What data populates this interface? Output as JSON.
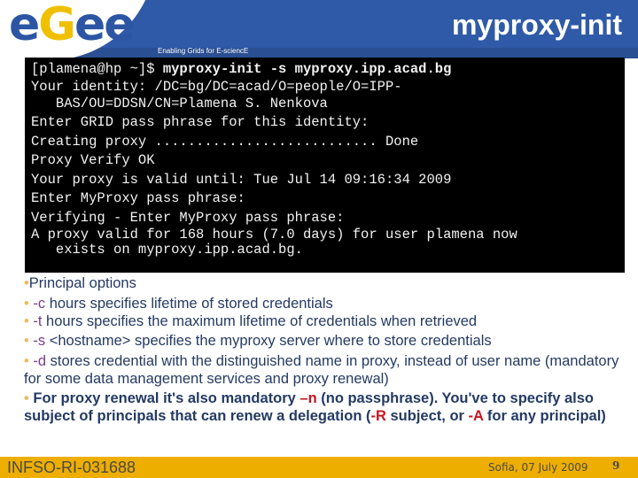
{
  "header": {
    "logo_letters": [
      "e",
      "G",
      "e",
      "e"
    ],
    "tagline": "Enabling Grids for E-sciencE",
    "title": "myproxy-init",
    "colors": {
      "header_blue": "#2f5aa8",
      "logo_blue": "#2c56a4",
      "logo_yellow": "#f0c000"
    }
  },
  "terminal": {
    "prompt": "[plamena@hp ~]$ ",
    "command": "myproxy-init -s myproxy.ipp.acad.bg",
    "lines": [
      "Your identity: /DC=bg/DC=acad/O=people/O=IPP-",
      "   BAS/OU=DDSN/CN=Plamena S. Nenkova",
      "Enter GRID pass phrase for this identity:",
      "Creating proxy ........................... Done",
      "Proxy Verify OK",
      "Your proxy is valid until: Tue Jul 14 09:16:34 2009",
      "Enter MyProxy pass phrase:",
      "Verifying - Enter MyProxy pass phrase:",
      "A proxy valid for 168 hours (7.0 days) for user plamena now",
      "   exists on myproxy.ipp.acad.bg."
    ]
  },
  "bullets": {
    "marker": "•",
    "heading": "Principal options",
    "items": [
      {
        "flag": "-c",
        "text": " hours specifies lifetime of stored credentials"
      },
      {
        "flag": "-t",
        "text": "  hours  specifies the maximum lifetime of credentials when retrieved"
      },
      {
        "flag": "-s",
        "text": " <hostname> specifies the myproxy server where to store credentials"
      },
      {
        "flag": "-d",
        "text": " stores credential with the distinguished name in proxy, instead of  user name (mandatory for some data management services  and proxy renewal)"
      }
    ],
    "renewal": {
      "part1": " For proxy renewal it's also mandatory ",
      "flag_n": "–n",
      "part2": " (no passphrase). You've to specify also subject of principals that can renew a delegation  (",
      "flag_R": "-R",
      "part3": " subject, or ",
      "flag_A": "-A",
      "part4": " for any principal)"
    }
  },
  "footer": {
    "project_id": "INFSO-RI-031688",
    "date": "Sofia, 07 July 2009",
    "page_number": "9",
    "color": "#eeae00"
  }
}
